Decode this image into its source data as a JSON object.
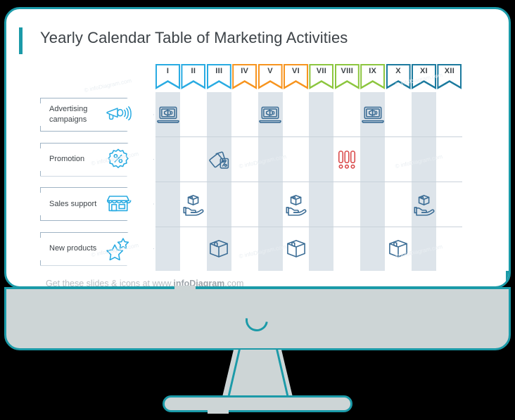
{
  "slide": {
    "title": "Yearly Calendar Table of Marketing Activities",
    "footer_prefix": "Get these slides & icons at www.",
    "footer_brand": "infoDiagram",
    "footer_suffix": ".com",
    "watermark": "© infoDiagram.com"
  },
  "colors": {
    "accent_teal": "#1b9aa8",
    "q1_blue": "#29abe2",
    "q2_orange": "#f7941e",
    "q3_green": "#8cc63f",
    "q4_teal": "#1b7a9e",
    "icon_blue": "#3d6e96",
    "label_blue": "#29abe2",
    "alert_red": "#d94a4a",
    "band_gray": "#dde4ea",
    "text_dark": "#3d4348"
  },
  "months": [
    {
      "label": "I",
      "color": "#29abe2"
    },
    {
      "label": "II",
      "color": "#29abe2"
    },
    {
      "label": "III",
      "color": "#29abe2"
    },
    {
      "label": "IV",
      "color": "#f7941e"
    },
    {
      "label": "V",
      "color": "#f7941e"
    },
    {
      "label": "VI",
      "color": "#f7941e"
    },
    {
      "label": "VII",
      "color": "#8cc63f"
    },
    {
      "label": "VIII",
      "color": "#8cc63f"
    },
    {
      "label": "IX",
      "color": "#8cc63f"
    },
    {
      "label": "X",
      "color": "#1b7a9e"
    },
    {
      "label": "XI",
      "color": "#1b7a9e"
    },
    {
      "label": "XII",
      "color": "#1b7a9e"
    }
  ],
  "rows": [
    {
      "label": "Advertising campaigns",
      "icon": "megaphone-icon",
      "marks": [
        {
          "month": "I",
          "icon": "laptop-megaphone-icon",
          "color": "#3d6e96"
        },
        {
          "month": "V",
          "icon": "laptop-megaphone-icon",
          "color": "#3d6e96"
        },
        {
          "month": "IX",
          "icon": "laptop-megaphone-icon",
          "color": "#3d6e96"
        }
      ]
    },
    {
      "label": "Promotion",
      "icon": "percent-badge-icon",
      "marks": [
        {
          "month": "III",
          "icon": "price-tags-percent-icon",
          "color": "#3d6e96"
        },
        {
          "month": "VIII",
          "icon": "triple-exclamation-icon",
          "color": "#d94a4a"
        }
      ]
    },
    {
      "label": "Sales support",
      "icon": "shop-icon",
      "marks": [
        {
          "month": "II",
          "icon": "hand-box-icon",
          "color": "#3d6e96"
        },
        {
          "month": "VI",
          "icon": "hand-box-icon",
          "color": "#3d6e96"
        },
        {
          "month": "XI",
          "icon": "hand-box-icon",
          "color": "#3d6e96"
        }
      ]
    },
    {
      "label": "New products",
      "icon": "stars-icon",
      "marks": [
        {
          "month": "III",
          "icon": "box-icon",
          "color": "#3d6e96"
        },
        {
          "month": "VI",
          "icon": "box-icon",
          "color": "#3d6e96"
        },
        {
          "month": "X",
          "icon": "box-icon",
          "color": "#3d6e96"
        }
      ]
    }
  ],
  "device": {
    "type": "desktop-monitor",
    "state_icon": "loading-spinner-icon"
  }
}
